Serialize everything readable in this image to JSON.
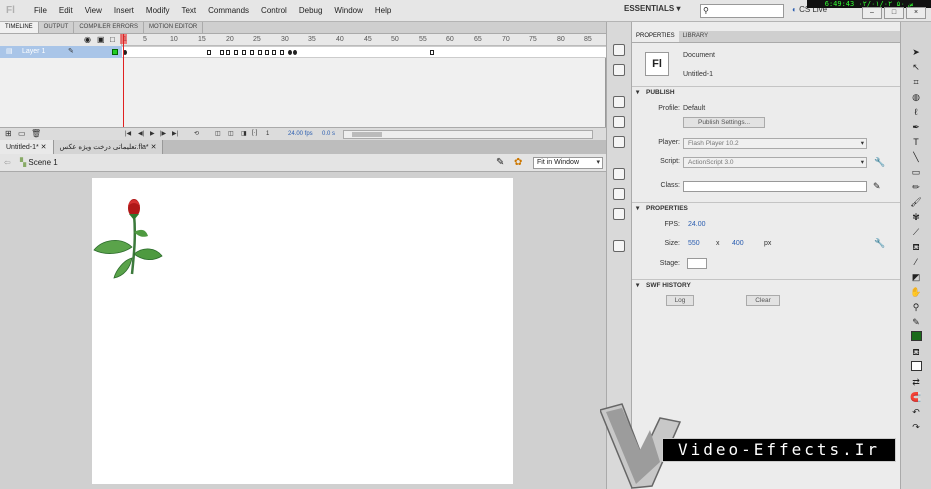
{
  "app": {
    "logo": "Fl"
  },
  "menu": [
    "File",
    "Edit",
    "View",
    "Insert",
    "Modify",
    "Text",
    "Commands",
    "Control",
    "Debug",
    "Window",
    "Help"
  ],
  "workspace": "ESSENTIALS",
  "clock": "6:49:43 ۰۲/۰۱/۰۲ ۵۰ س",
  "cs_live": "CS Live",
  "timeline": {
    "tabs": [
      "TIMELINE",
      "OUTPUT",
      "COMPILER ERRORS",
      "MOTION EDITOR"
    ],
    "ruler": [
      "1",
      "5",
      "10",
      "15",
      "20",
      "25",
      "30",
      "35",
      "40",
      "45",
      "50",
      "55",
      "60",
      "65",
      "70",
      "75",
      "80",
      "85"
    ],
    "layer_name": "Layer 1",
    "current_frame": "1",
    "fps": "24.00 fps",
    "elapsed": "0.0 s"
  },
  "document_tabs": [
    {
      "label": "Untitled-1*"
    },
    {
      "label": "تعلیماتی درخت ویژه عکس.fla*"
    }
  ],
  "edit_bar": {
    "scene": "Scene 1",
    "zoom": "Fit in Window"
  },
  "properties": {
    "tabs": [
      "PROPERTIES",
      "LIBRARY"
    ],
    "doc_type": "Document",
    "doc_name": "Untitled-1",
    "doc_icon": "Fl",
    "publish": {
      "heading": "PUBLISH",
      "profile_label": "Profile:",
      "profile_value": "Default",
      "settings_button": "Publish Settings...",
      "player_label": "Player:",
      "player_value": "Flash Player 10.2",
      "script_label": "Script:",
      "script_value": "ActionScript 3.0",
      "class_label": "Class:"
    },
    "props": {
      "heading": "PROPERTIES",
      "fps_label": "FPS:",
      "fps_value": "24.00",
      "size_label": "Size:",
      "width": "550",
      "x": "x",
      "height": "400",
      "unit": "px",
      "stage_label": "Stage:"
    },
    "swf_history": {
      "heading": "SWF HISTORY",
      "log_button": "Log",
      "clear_button": "Clear"
    }
  },
  "watermark": "Video-Effects.Ir"
}
